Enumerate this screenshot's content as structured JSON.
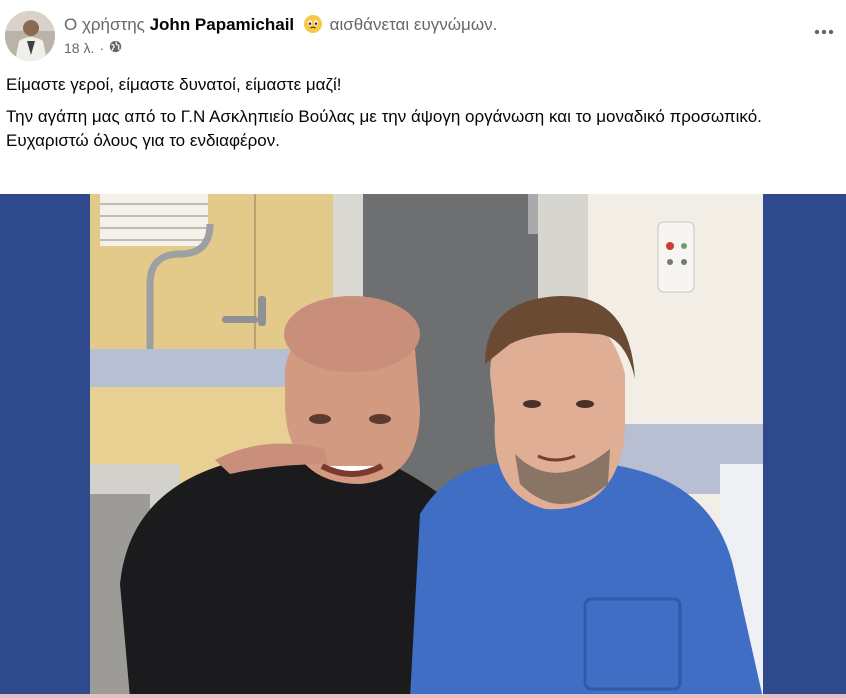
{
  "post": {
    "prefix": "Ο χρήστης",
    "author": "John Papamichail",
    "feeling": "αισθάνεται ευγνώμων.",
    "time": "18 λ.",
    "privacy_icon": "globe-icon",
    "more_icon": "more-options-icon",
    "text_lines": [
      "Είμαστε γεροί, είμαστε δυνατοί, είμαστε μαζί!",
      "Την αγάπη μας από το Γ.Ν Ασκληπιείο Βούλας με την άψογη οργάνωση και το μοναδικό προσωπικό.",
      "Ευχαριστώ όλους για το ενδιαφέρον."
    ]
  },
  "colors": {
    "photo_background": "#2e4a8d",
    "secondary_text": "#65676b"
  }
}
